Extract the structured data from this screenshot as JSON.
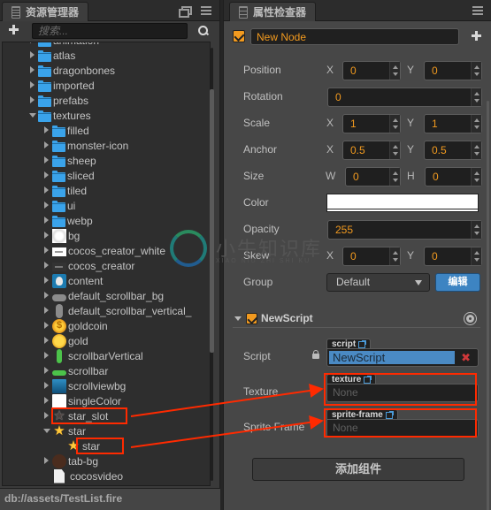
{
  "assets_panel": {
    "title": "资源管理器",
    "icon": "assets-panel-icon",
    "search_placeholder": "搜索...",
    "tree": [
      {
        "label": "animation",
        "type": "folder",
        "depth": 1,
        "expanded": false,
        "partial": true
      },
      {
        "label": "atlas",
        "type": "folder",
        "depth": 1,
        "expanded": false
      },
      {
        "label": "dragonbones",
        "type": "folder",
        "depth": 1,
        "expanded": false
      },
      {
        "label": "imported",
        "type": "folder",
        "depth": 1,
        "expanded": false
      },
      {
        "label": "prefabs",
        "type": "folder",
        "depth": 1,
        "expanded": false
      },
      {
        "label": "textures",
        "type": "folder",
        "depth": 1,
        "expanded": true
      },
      {
        "label": "filled",
        "type": "folder",
        "depth": 2,
        "expanded": false
      },
      {
        "label": "monster-icon",
        "type": "folder",
        "depth": 2,
        "expanded": false
      },
      {
        "label": "sheep",
        "type": "folder",
        "depth": 2,
        "expanded": false
      },
      {
        "label": "sliced",
        "type": "folder",
        "depth": 2,
        "expanded": false
      },
      {
        "label": "tiled",
        "type": "folder",
        "depth": 2,
        "expanded": false
      },
      {
        "label": "ui",
        "type": "folder",
        "depth": 2,
        "expanded": false
      },
      {
        "label": "webp",
        "type": "folder",
        "depth": 2,
        "expanded": false
      },
      {
        "label": "bg",
        "type": "texture",
        "thumb": "bg",
        "depth": 2,
        "expanded": false
      },
      {
        "label": "cocos_creator_white",
        "type": "texture",
        "thumb": "logo",
        "depth": 2,
        "expanded": false
      },
      {
        "label": "cocos_creator",
        "type": "texture",
        "thumb": "logo-dark",
        "depth": 2,
        "expanded": false
      },
      {
        "label": "content",
        "type": "texture",
        "thumb": "content",
        "depth": 2,
        "expanded": false
      },
      {
        "label": "default_scrollbar_bg",
        "type": "texture",
        "thumb": "pill-h",
        "depth": 2,
        "expanded": false
      },
      {
        "label": "default_scrollbar_vertical_",
        "type": "texture",
        "thumb": "pill-v",
        "depth": 2,
        "expanded": false
      },
      {
        "label": "goldcoin",
        "type": "texture",
        "thumb": "coin",
        "depth": 2,
        "expanded": false
      },
      {
        "label": "gold",
        "type": "texture",
        "thumb": "gold",
        "depth": 2,
        "expanded": false
      },
      {
        "label": "scrollbarVertical",
        "type": "texture",
        "thumb": "green-v",
        "depth": 2,
        "expanded": false
      },
      {
        "label": "scrollbar",
        "type": "texture",
        "thumb": "green-h",
        "depth": 2,
        "expanded": false
      },
      {
        "label": "scrollviewbg",
        "type": "texture",
        "thumb": "scrollview",
        "depth": 2,
        "expanded": false
      },
      {
        "label": "singleColor",
        "type": "texture",
        "thumb": "white",
        "depth": 2,
        "expanded": false
      },
      {
        "label": "star_slot",
        "type": "texture",
        "thumb": "star-dark",
        "depth": 2,
        "expanded": false,
        "highlighted": true
      },
      {
        "label": "star",
        "type": "texture",
        "thumb": "star",
        "depth": 2,
        "expanded": true
      },
      {
        "label": "star",
        "type": "sprite-frame",
        "thumb": "star",
        "depth": 3,
        "leaf": true,
        "highlighted": true
      },
      {
        "label": "tab-bg",
        "type": "texture",
        "thumb": "tabbg",
        "depth": 2,
        "expanded": false
      },
      {
        "label": "cocosvideo",
        "type": "file",
        "thumb": "file",
        "depth": 1,
        "leaf": true
      }
    ],
    "status_path": "db://assets/TestList.fire"
  },
  "inspector_panel": {
    "title": "属性检查器",
    "node": {
      "enabled": true,
      "name": "New Node"
    },
    "properties": {
      "position": {
        "label": "Position",
        "x_label": "X",
        "x": "0",
        "y_label": "Y",
        "y": "0"
      },
      "rotation": {
        "label": "Rotation",
        "value": "0"
      },
      "scale": {
        "label": "Scale",
        "x_label": "X",
        "x": "1",
        "y_label": "Y",
        "y": "1"
      },
      "anchor": {
        "label": "Anchor",
        "x_label": "X",
        "x": "0.5",
        "y_label": "Y",
        "y": "0.5"
      },
      "size": {
        "label": "Size",
        "w_label": "W",
        "w": "0",
        "h_label": "H",
        "h": "0"
      },
      "color": {
        "label": "Color",
        "value": "#ffffff"
      },
      "opacity": {
        "label": "Opacity",
        "value": "255"
      },
      "skew": {
        "label": "Skew",
        "x_label": "X",
        "x": "0",
        "y_label": "Y",
        "y": "0"
      },
      "group": {
        "label": "Group",
        "value": "Default",
        "edit_label": "编辑"
      }
    },
    "component": {
      "name": "NewScript",
      "enabled": true,
      "expanded": true,
      "fields": {
        "script": {
          "label": "Script",
          "type_tag": "script",
          "value": "NewScript"
        },
        "texture": {
          "label": "Texture",
          "type_tag": "texture",
          "value": "None"
        },
        "sprite_frame": {
          "label": "Sprite Frame",
          "type_tag": "sprite-frame",
          "value": "None"
        }
      }
    },
    "add_component_label": "添加组件"
  },
  "annotations": {
    "color": "#ff2a00",
    "arrows": [
      {
        "from": "star_slot",
        "to": "texture"
      },
      {
        "from": "star (sprite frame)",
        "to": "sprite-frame"
      }
    ]
  },
  "watermark": {
    "text": "小牛知识库",
    "subtext": "XIAO NIU ZHI SHI KU"
  },
  "colors": {
    "accent_orange": "#f29a1f",
    "folder_blue": "#3aa3ea",
    "button_blue": "#3d84c2",
    "highlight_red": "#ff2a00"
  }
}
